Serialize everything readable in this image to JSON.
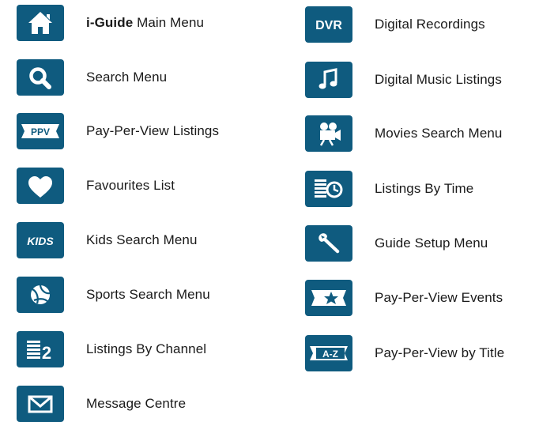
{
  "left_column": [
    {
      "brand": "i-Guide",
      "label": " Main Menu",
      "icon": "home-icon"
    },
    {
      "label": "Search Menu",
      "icon": "search-icon"
    },
    {
      "label": "Pay-Per-View Listings",
      "icon": "ppv-ticket-icon",
      "icon_text": "PPV"
    },
    {
      "label": "Favourites List",
      "icon": "heart-icon"
    },
    {
      "label": "Kids Search Menu",
      "icon": "kids-icon",
      "icon_text": "KIDS"
    },
    {
      "label": "Sports Search Menu",
      "icon": "sports-ball-icon"
    },
    {
      "label": "Listings By Channel",
      "icon": "listings-channel-icon",
      "icon_text": "2"
    },
    {
      "label": "Message Centre",
      "icon": "envelope-icon"
    }
  ],
  "right_column": [
    {
      "label": "Digital Recordings",
      "icon": "dvr-icon",
      "icon_text": "DVR"
    },
    {
      "label": "Digital Music Listings",
      "icon": "music-note-icon"
    },
    {
      "label": "Movies Search Menu",
      "icon": "movie-camera-icon"
    },
    {
      "label": "Listings By Time",
      "icon": "listings-time-icon"
    },
    {
      "label": "Guide Setup Menu",
      "icon": "wrench-icon"
    },
    {
      "label": "Pay-Per-View Events",
      "icon": "ppv-star-ticket-icon"
    },
    {
      "label": "Pay-Per-View by Title",
      "icon": "ppv-az-ticket-icon",
      "icon_text": "A-Z"
    }
  ],
  "colors": {
    "icon_bg": "#0f5b7f",
    "icon_fg": "#ffffff",
    "text": "#1a1a1a"
  }
}
